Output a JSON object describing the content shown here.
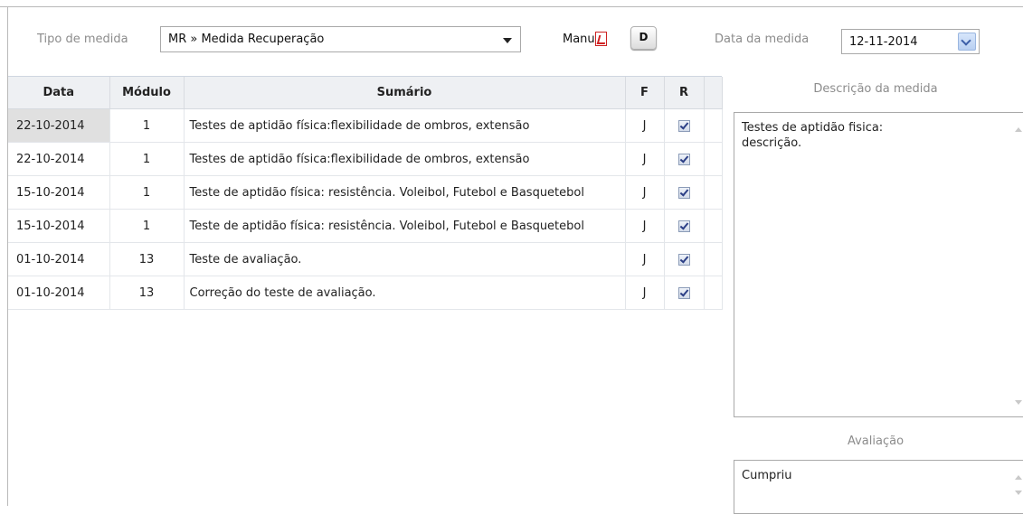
{
  "form": {
    "tipo_label": "Tipo de medida",
    "tipo_value": "MR » Medida Recuperação",
    "manual_label": "Manual",
    "d_button": "D",
    "data_label": "Data da medida",
    "data_value": "12-11-2014"
  },
  "table": {
    "headers": [
      "Data",
      "Módulo",
      "Sumário",
      "F",
      "R"
    ],
    "rows": [
      {
        "data": "22-10-2014",
        "modulo": "1",
        "sumario": "Testes de aptidão física:flexibilidade de ombros, extensão",
        "f": "J",
        "r": true
      },
      {
        "data": "22-10-2014",
        "modulo": "1",
        "sumario": "Testes de aptidão física:flexibilidade de ombros, extensão",
        "f": "J",
        "r": true
      },
      {
        "data": "15-10-2014",
        "modulo": "1",
        "sumario": "Teste de aptidão física: resistência. Voleibol, Futebol e Basquetebol",
        "f": "J",
        "r": true
      },
      {
        "data": "15-10-2014",
        "modulo": "1",
        "sumario": "Teste de aptidão física: resistência. Voleibol, Futebol e Basquetebol",
        "f": "J",
        "r": true
      },
      {
        "data": "01-10-2014",
        "modulo": "13",
        "sumario": "Teste de avaliação.",
        "f": "J",
        "r": true
      },
      {
        "data": "01-10-2014",
        "modulo": "13",
        "sumario": "Correção do teste de avaliação.",
        "f": "J",
        "r": true
      }
    ]
  },
  "descricao": {
    "title": "Descrição da medida",
    "text": "Testes de aptidão fisica:\ndescrição."
  },
  "avaliacao": {
    "title": "Avaliação",
    "text": "Cumpriu"
  }
}
